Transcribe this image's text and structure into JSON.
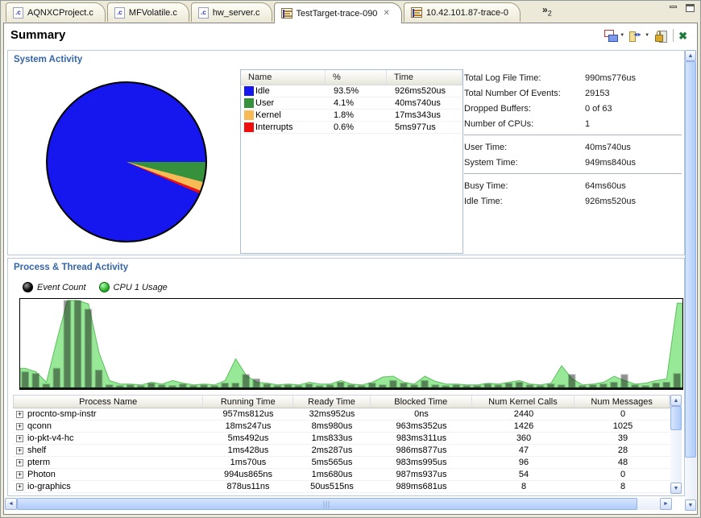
{
  "window": {
    "tabs": [
      {
        "label": "AQNXCProject.c",
        "icon": "c-file",
        "active": false,
        "closable": false
      },
      {
        "label": "MFVolatile.c",
        "icon": "c-file",
        "active": false,
        "closable": false
      },
      {
        "label": "hw_server.c",
        "icon": "c-file",
        "active": false,
        "closable": false
      },
      {
        "label": "TestTarget-trace-090",
        "icon": "trace",
        "active": true,
        "closable": true
      },
      {
        "label": "10.42.101.87-trace-0",
        "icon": "trace",
        "active": false,
        "closable": false
      }
    ],
    "tab_overflow_count": "2"
  },
  "header": {
    "title": "Summary"
  },
  "icons": {
    "chevron": "»",
    "tab_close": "✕",
    "view_close": "✖",
    "dropdown": "▼",
    "expander": "+",
    "scroll_up": "▲",
    "scroll_down": "▼",
    "scroll_left": "◄",
    "scroll_right": "►"
  },
  "system_activity": {
    "title": "System Activity",
    "table": {
      "columns": [
        "Name",
        "%",
        "Time"
      ],
      "rows": [
        {
          "name": "Idle",
          "color": "#1616ee",
          "percent": "93.5%",
          "time": "926ms520us"
        },
        {
          "name": "User",
          "color": "#35913c",
          "percent": "4.1%",
          "time": "40ms740us"
        },
        {
          "name": "Kernel",
          "color": "#f7ba57",
          "percent": "1.8%",
          "time": "17ms343us"
        },
        {
          "name": "Interrupts",
          "color": "#ee0f0f",
          "percent": "0.6%",
          "time": "5ms977us"
        }
      ]
    },
    "stats_groups": [
      [
        {
          "label": "Total Log File Time:",
          "value": "990ms776us"
        },
        {
          "label": "Total Number Of Events:",
          "value": "29153"
        },
        {
          "label": "Dropped Buffers:",
          "value": "0 of 63"
        },
        {
          "label": "Number of CPUs:",
          "value": "1"
        }
      ],
      [
        {
          "label": "User Time:",
          "value": "40ms740us"
        },
        {
          "label": "System Time:",
          "value": "949ms840us"
        }
      ],
      [
        {
          "label": "Busy Time:",
          "value": "64ms60us"
        },
        {
          "label": "Idle Time:",
          "value": "926ms520us"
        }
      ]
    ]
  },
  "process_thread_activity": {
    "title": "Process & Thread Activity",
    "legend": [
      {
        "label": "Event Count",
        "color": "#101010"
      },
      {
        "label": "CPU 1 Usage",
        "color": "#3ecf3e"
      }
    ],
    "table": {
      "columns": [
        "Process Name",
        "Running Time",
        "Ready Time",
        "Blocked Time",
        "Num Kernel Calls",
        "Num Messages"
      ],
      "rows": [
        [
          "procnto-smp-instr",
          "957ms812us",
          "32ms952us",
          "0ns",
          "2440",
          "0"
        ],
        [
          "qconn",
          "18ms247us",
          "8ms980us",
          "963ms352us",
          "1426",
          "1025"
        ],
        [
          "io-pkt-v4-hc",
          "5ms492us",
          "1ms833us",
          "983ms311us",
          "360",
          "39"
        ],
        [
          "shelf",
          "1ms428us",
          "2ms287us",
          "986ms877us",
          "47",
          "28"
        ],
        [
          "pterm",
          "1ms70us",
          "5ms565us",
          "983ms995us",
          "96",
          "48"
        ],
        [
          "Photon",
          "994us865ns",
          "1ms680us",
          "987ms937us",
          "54",
          "0"
        ],
        [
          "io-graphics",
          "878us11ns",
          "50us515ns",
          "989ms681us",
          "8",
          "8"
        ]
      ]
    }
  },
  "chart_data": [
    {
      "type": "pie",
      "title": "System Activity",
      "labels": [
        "Idle",
        "User",
        "Kernel",
        "Interrupts"
      ],
      "values": [
        93.5,
        4.1,
        1.8,
        0.6
      ],
      "times": [
        "926ms520us",
        "40ms740us",
        "17ms343us",
        "5ms977us"
      ],
      "colors": [
        "#1616ee",
        "#35913c",
        "#f7ba57",
        "#ee0f0f"
      ],
      "draw_order": [
        1,
        2,
        3,
        0
      ],
      "start_angle_deg": 0,
      "direction": "clockwise",
      "legend_position": "table-right"
    },
    {
      "type": "bar",
      "title": "Process & Thread Activity",
      "note": "timeline histogram, no axis tick labels shown; values estimated as percent of plot height",
      "x": "time bins 0-62 across trace duration",
      "ylim": [
        0,
        100
      ],
      "grid": false,
      "series": [
        {
          "name": "Event Count",
          "style": "bar",
          "color": "#8f8f8f",
          "values": [
            18,
            16,
            4,
            22,
            100,
            100,
            90,
            20,
            3,
            2,
            3,
            2,
            5,
            3,
            2,
            4,
            2,
            3,
            2,
            5,
            5,
            15,
            10,
            4,
            2,
            3,
            2,
            4,
            2,
            3,
            6,
            3,
            2,
            5,
            3,
            8,
            5,
            3,
            8,
            3,
            2,
            3,
            2,
            2,
            4,
            3,
            5,
            6,
            3,
            2,
            4,
            3,
            15,
            2,
            3,
            4,
            6,
            15,
            3,
            2,
            5,
            6,
            16
          ]
        },
        {
          "name": "CPU 1 Usage",
          "style": "area",
          "color": "#97e897",
          "values": [
            22,
            18,
            6,
            55,
            100,
            100,
            96,
            40,
            8,
            4,
            4,
            3,
            6,
            4,
            8,
            5,
            3,
            4,
            3,
            8,
            33,
            14,
            6,
            5,
            3,
            4,
            3,
            6,
            4,
            4,
            8,
            4,
            3,
            6,
            12,
            13,
            6,
            4,
            13,
            7,
            4,
            4,
            3,
            3,
            5,
            4,
            6,
            8,
            4,
            3,
            5,
            25,
            10,
            3,
            4,
            6,
            13,
            8,
            4,
            5,
            8,
            10,
            97
          ]
        }
      ]
    }
  ]
}
